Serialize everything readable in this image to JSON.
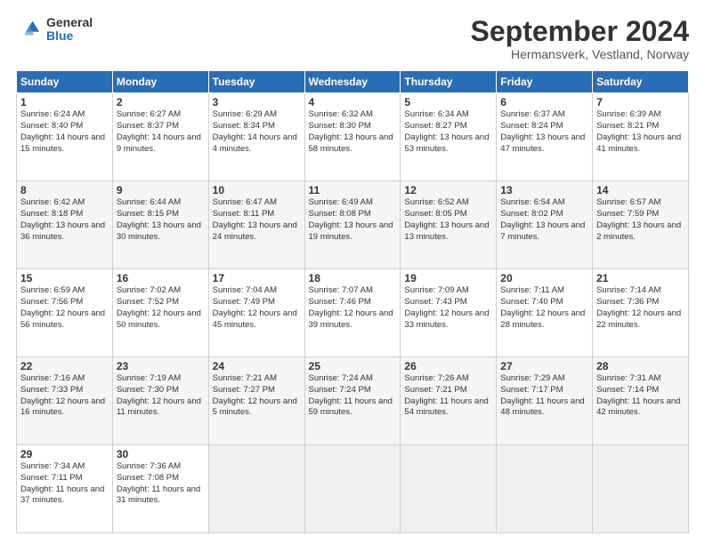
{
  "logo": {
    "general": "General",
    "blue": "Blue"
  },
  "header": {
    "title": "September 2024",
    "subtitle": "Hermansverk, Vestland, Norway"
  },
  "weekdays": [
    "Sunday",
    "Monday",
    "Tuesday",
    "Wednesday",
    "Thursday",
    "Friday",
    "Saturday"
  ],
  "weeks": [
    [
      {
        "day": "1",
        "sunrise": "6:24 AM",
        "sunset": "8:40 PM",
        "daylight": "14 hours and 15 minutes."
      },
      {
        "day": "2",
        "sunrise": "6:27 AM",
        "sunset": "8:37 PM",
        "daylight": "14 hours and 9 minutes."
      },
      {
        "day": "3",
        "sunrise": "6:29 AM",
        "sunset": "8:34 PM",
        "daylight": "14 hours and 4 minutes."
      },
      {
        "day": "4",
        "sunrise": "6:32 AM",
        "sunset": "8:30 PM",
        "daylight": "13 hours and 58 minutes."
      },
      {
        "day": "5",
        "sunrise": "6:34 AM",
        "sunset": "8:27 PM",
        "daylight": "13 hours and 53 minutes."
      },
      {
        "day": "6",
        "sunrise": "6:37 AM",
        "sunset": "8:24 PM",
        "daylight": "13 hours and 47 minutes."
      },
      {
        "day": "7",
        "sunrise": "6:39 AM",
        "sunset": "8:21 PM",
        "daylight": "13 hours and 41 minutes."
      }
    ],
    [
      {
        "day": "8",
        "sunrise": "6:42 AM",
        "sunset": "8:18 PM",
        "daylight": "13 hours and 36 minutes."
      },
      {
        "day": "9",
        "sunrise": "6:44 AM",
        "sunset": "8:15 PM",
        "daylight": "13 hours and 30 minutes."
      },
      {
        "day": "10",
        "sunrise": "6:47 AM",
        "sunset": "8:11 PM",
        "daylight": "13 hours and 24 minutes."
      },
      {
        "day": "11",
        "sunrise": "6:49 AM",
        "sunset": "8:08 PM",
        "daylight": "13 hours and 19 minutes."
      },
      {
        "day": "12",
        "sunrise": "6:52 AM",
        "sunset": "8:05 PM",
        "daylight": "13 hours and 13 minutes."
      },
      {
        "day": "13",
        "sunrise": "6:54 AM",
        "sunset": "8:02 PM",
        "daylight": "13 hours and 7 minutes."
      },
      {
        "day": "14",
        "sunrise": "6:57 AM",
        "sunset": "7:59 PM",
        "daylight": "13 hours and 2 minutes."
      }
    ],
    [
      {
        "day": "15",
        "sunrise": "6:59 AM",
        "sunset": "7:56 PM",
        "daylight": "12 hours and 56 minutes."
      },
      {
        "day": "16",
        "sunrise": "7:02 AM",
        "sunset": "7:52 PM",
        "daylight": "12 hours and 50 minutes."
      },
      {
        "day": "17",
        "sunrise": "7:04 AM",
        "sunset": "7:49 PM",
        "daylight": "12 hours and 45 minutes."
      },
      {
        "day": "18",
        "sunrise": "7:07 AM",
        "sunset": "7:46 PM",
        "daylight": "12 hours and 39 minutes."
      },
      {
        "day": "19",
        "sunrise": "7:09 AM",
        "sunset": "7:43 PM",
        "daylight": "12 hours and 33 minutes."
      },
      {
        "day": "20",
        "sunrise": "7:11 AM",
        "sunset": "7:40 PM",
        "daylight": "12 hours and 28 minutes."
      },
      {
        "day": "21",
        "sunrise": "7:14 AM",
        "sunset": "7:36 PM",
        "daylight": "12 hours and 22 minutes."
      }
    ],
    [
      {
        "day": "22",
        "sunrise": "7:16 AM",
        "sunset": "7:33 PM",
        "daylight": "12 hours and 16 minutes."
      },
      {
        "day": "23",
        "sunrise": "7:19 AM",
        "sunset": "7:30 PM",
        "daylight": "12 hours and 11 minutes."
      },
      {
        "day": "24",
        "sunrise": "7:21 AM",
        "sunset": "7:27 PM",
        "daylight": "12 hours and 5 minutes."
      },
      {
        "day": "25",
        "sunrise": "7:24 AM",
        "sunset": "7:24 PM",
        "daylight": "11 hours and 59 minutes."
      },
      {
        "day": "26",
        "sunrise": "7:26 AM",
        "sunset": "7:21 PM",
        "daylight": "11 hours and 54 minutes."
      },
      {
        "day": "27",
        "sunrise": "7:29 AM",
        "sunset": "7:17 PM",
        "daylight": "11 hours and 48 minutes."
      },
      {
        "day": "28",
        "sunrise": "7:31 AM",
        "sunset": "7:14 PM",
        "daylight": "11 hours and 42 minutes."
      }
    ],
    [
      {
        "day": "29",
        "sunrise": "7:34 AM",
        "sunset": "7:11 PM",
        "daylight": "11 hours and 37 minutes."
      },
      {
        "day": "30",
        "sunrise": "7:36 AM",
        "sunset": "7:08 PM",
        "daylight": "11 hours and 31 minutes."
      },
      null,
      null,
      null,
      null,
      null
    ]
  ]
}
